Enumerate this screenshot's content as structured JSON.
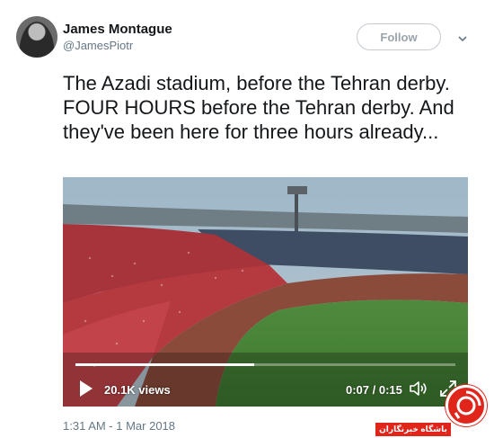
{
  "author": {
    "name": "James Montague",
    "handle": "@JamesPiotr"
  },
  "follow_button": {
    "label": "Follow"
  },
  "tweet": {
    "text": "The Azadi stadium, before the Tehran derby. FOUR HOURS before the Tehran derby. And they've been here for three hours already...",
    "timestamp": "1:31 AM - 1 Mar 2018"
  },
  "video": {
    "views": "20.1K views",
    "duration": "0:07 / 0:15",
    "progress_fraction": 0.47
  },
  "watermark": {
    "label": "باشگاه خبرنگاران"
  },
  "icons": {
    "play": "play-icon",
    "volume": "volume-icon",
    "fullscreen": "fullscreen-icon",
    "caret": "chevron-down-icon"
  }
}
